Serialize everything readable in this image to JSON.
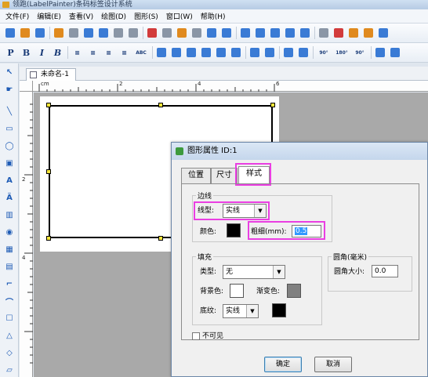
{
  "window": {
    "title": "领跑(LabelPainter)条码标签设计系统"
  },
  "menu": [
    {
      "label": "文件(F)"
    },
    {
      "label": "编辑(E)"
    },
    {
      "label": "查看(V)"
    },
    {
      "label": "绘图(D)"
    },
    {
      "label": "图形(S)"
    },
    {
      "label": "窗口(W)"
    },
    {
      "label": "帮助(H)"
    }
  ],
  "toolbar1": {
    "icons": [
      "new-icon",
      "open-icon",
      "save-icon",
      "settings-icon",
      "print-icon",
      "print-preview-icon",
      "database-icon",
      "grid-icon",
      "barcode-icon",
      "cut-icon",
      "copy-icon",
      "paste-icon",
      "delete-icon",
      "undo-icon",
      "redo-icon",
      "zoom-in-icon",
      "zoom-out-icon",
      "zoom-fit-icon",
      "zoom-actual-icon",
      "zoom-custom-icon",
      "eye-icon",
      "eye-off-icon",
      "lock-icon",
      "unlock-icon",
      "layer-icon"
    ]
  },
  "toolbar2": {
    "text_buttons": [
      "P",
      "B",
      "I",
      "B"
    ],
    "abc_label": "ABC",
    "rotate_labels": [
      "90°",
      "180°",
      "90°"
    ]
  },
  "document": {
    "tab_label": "未命名-1"
  },
  "ruler": {
    "unit": "cm",
    "h_marks": [
      "2",
      "4",
      "6"
    ],
    "v_marks": [
      "2",
      "4"
    ]
  },
  "dialog": {
    "title": "图形属性 ID:1",
    "tabs": [
      {
        "label": "位置"
      },
      {
        "label": "尺寸"
      },
      {
        "label": "样式"
      }
    ],
    "border_group": {
      "label": "边线",
      "line_type_label": "线型:",
      "line_type_value": "实线",
      "color_label": "颜色:",
      "width_label": "粗细(mm):",
      "width_value": "0.5"
    },
    "fill_group": {
      "label": "填充",
      "type_label": "类型:",
      "type_value": "无",
      "bg_color_label": "背景色:",
      "gradient_label": "渐变色:",
      "pattern_label": "底纹:",
      "pattern_value": "实线"
    },
    "corner_group": {
      "label": "圆角(毫米)",
      "radius_label": "圆角大小:",
      "radius_value": "0.0"
    },
    "invisible_label": "不可见",
    "ok_label": "确定",
    "cancel_label": "取消"
  },
  "colors": {
    "highlight": "#ea3fe2",
    "border_color": "#000000",
    "bg_color": "#ffffff",
    "gradient_color": "#808080",
    "pattern_color": "#000000"
  }
}
